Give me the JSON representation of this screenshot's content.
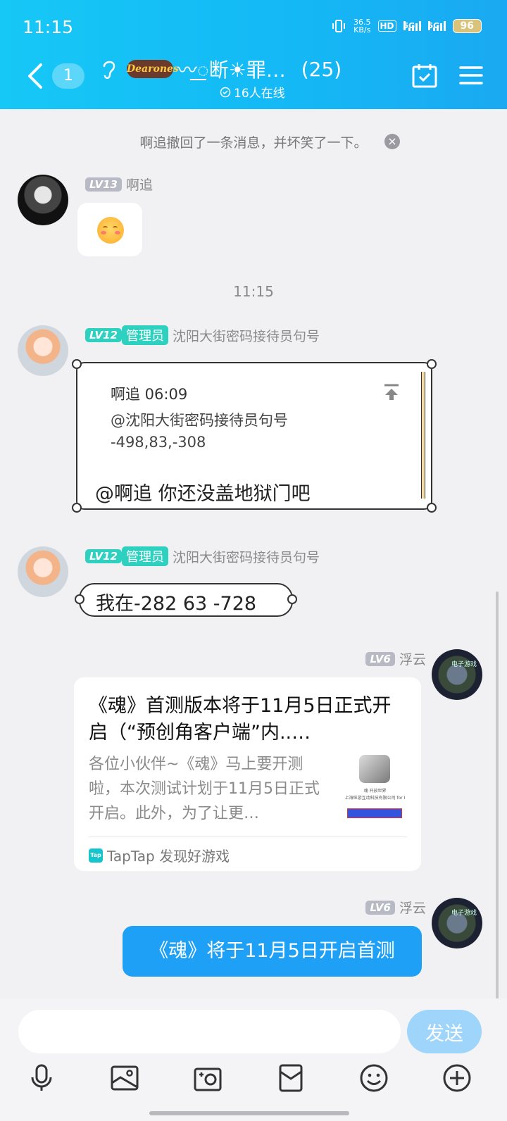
{
  "status_bar": {
    "time": "11:15",
    "net_speed_value": "36.5",
    "net_speed_unit": "KB/s",
    "hd_label": "HD",
    "sim1_label": "5G",
    "sim2_label": "5G",
    "battery": "96"
  },
  "header": {
    "unread_count": "1",
    "logo_text": "Dearones",
    "group_title": "〰꯭断☀罪…",
    "member_count": "(25)",
    "online_status": "16人在线"
  },
  "system_message": {
    "text": "啊追撤回了一条消息，并坏笑了一下。"
  },
  "messages": [
    {
      "level": "LV13",
      "sender": "啊追"
    },
    {
      "level": "LV12",
      "role": "管理员",
      "sender": "沈阳大街密码接待员句号",
      "reply_name": "啊追 06:09",
      "reply_line1": "@沈阳大街密码接待员句号",
      "reply_line2": "-498,83,-308",
      "text": "@啊追 你还没盖地狱门吧"
    },
    {
      "level": "LV12",
      "role": "管理员",
      "sender": "沈阳大街密码接待员句号",
      "text": "我在-282 63 -728"
    },
    {
      "level": "LV6",
      "sender": "浮云",
      "card_title": "《魂》首测版本将于11月5日正式开启（“预创角客户端”内..…",
      "card_desc": "各位小伙伴~《魂》马上要开测啦，本次测试计划于11月5日正式开启。此外，为了让更…",
      "thumb_line1": "魂 开放世界",
      "thumb_line2": "上海纵游互动科技有限公司 for I",
      "card_source": "TapTap 发现好游戏",
      "tap_icon_text": "Tap"
    },
    {
      "level": "LV6",
      "sender": "浮云",
      "text": "《魂》将于11月5日开启首测"
    }
  ],
  "timestamp": "11:15",
  "avatar_text": "电子游戏",
  "input": {
    "placeholder": "",
    "send_label": "发送"
  },
  "colors": {
    "header_gradient_start": "#16c8f6",
    "header_gradient_end": "#1aa9f2",
    "admin_tag": "#2ed0c0",
    "sent_bubble": "#1da0f5",
    "send_button": "#9fd5fa"
  },
  "icons": [
    "back-icon",
    "ear-icon",
    "calendar-check-icon",
    "menu-icon",
    "microphone-icon",
    "image-icon",
    "camera-icon",
    "red-packet-icon",
    "emoji-icon",
    "plus-icon"
  ]
}
